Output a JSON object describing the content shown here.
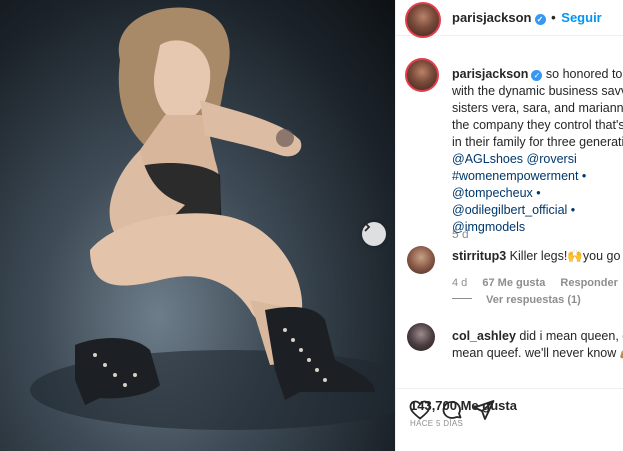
{
  "post": {
    "username": "parisjackson",
    "follow_label": "Seguir",
    "caption_username": "parisjackson",
    "caption_lines": [
      "so honored to wor",
      "with the dynamic business savvy",
      "sisters vera, sara, and marianna an",
      "the company they control that's b",
      "in their family for three generation"
    ],
    "tags": [
      "@AGLshoes @roversi",
      "#womenempowerment •",
      "@tompecheux •",
      "@odilegilbert_official •",
      "@imgmodels"
    ],
    "caption_time": "5 d",
    "likes": "143,700 Me gusta",
    "posted_ago": "HACE 5 DÍAS"
  },
  "comments": [
    {
      "username": "stirritup3",
      "text": "Killer legs!",
      "emoji": "🙌",
      "text_after": "you go girl!",
      "time": "4 d",
      "likes": "67 Me gusta",
      "reply_label": "Responder",
      "view_replies": "Ver respuestas (1)"
    },
    {
      "username": "col_ashley",
      "text": "did i mean queen, did i",
      "line2": "mean queef. we'll never know",
      "emoji": "🙈"
    }
  ],
  "icons": [
    "next-arrow-icon",
    "heart-icon",
    "comment-icon",
    "share-icon",
    "verified-badge-icon"
  ],
  "colors": {
    "accent": "#0095f6",
    "verified": "#3897f0",
    "story_ring": "#e33e4b"
  }
}
